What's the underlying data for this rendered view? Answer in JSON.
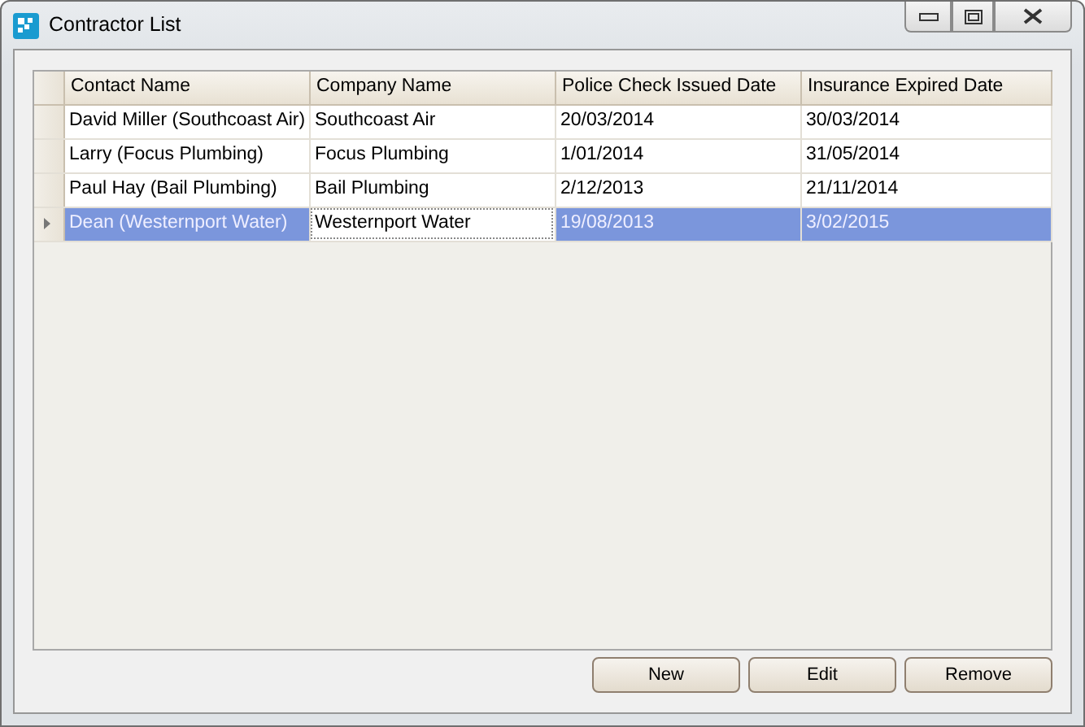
{
  "window": {
    "title": "Contractor List"
  },
  "table": {
    "columns": [
      "Contact Name",
      "Company Name",
      "Police Check Issued Date",
      "Insurance Expired Date"
    ],
    "rows": [
      {
        "selected": false,
        "cells": [
          {
            "text": "David Miller (Southcoast Air)",
            "focused": false
          },
          {
            "text": "Southcoast Air",
            "focused": false
          },
          {
            "text": "20/03/2014",
            "focused": false
          },
          {
            "text": "30/03/2014",
            "focused": false
          }
        ]
      },
      {
        "selected": false,
        "cells": [
          {
            "text": "Larry (Focus Plumbing)",
            "focused": false
          },
          {
            "text": "Focus Plumbing",
            "focused": false
          },
          {
            "text": "1/01/2014",
            "focused": false
          },
          {
            "text": "31/05/2014",
            "focused": false
          }
        ]
      },
      {
        "selected": false,
        "cells": [
          {
            "text": "Paul Hay (Bail Plumbing)",
            "focused": false
          },
          {
            "text": "Bail Plumbing",
            "focused": false
          },
          {
            "text": "2/12/2013",
            "focused": false
          },
          {
            "text": "21/11/2014",
            "focused": false
          }
        ]
      },
      {
        "selected": true,
        "cells": [
          {
            "text": "Dean (Westernport Water)",
            "focused": false
          },
          {
            "text": "Westernport Water",
            "focused": true
          },
          {
            "text": "19/08/2013",
            "focused": false
          },
          {
            "text": "3/02/2015",
            "focused": false
          }
        ]
      }
    ]
  },
  "buttons": [
    "New",
    "Edit",
    "Remove"
  ]
}
